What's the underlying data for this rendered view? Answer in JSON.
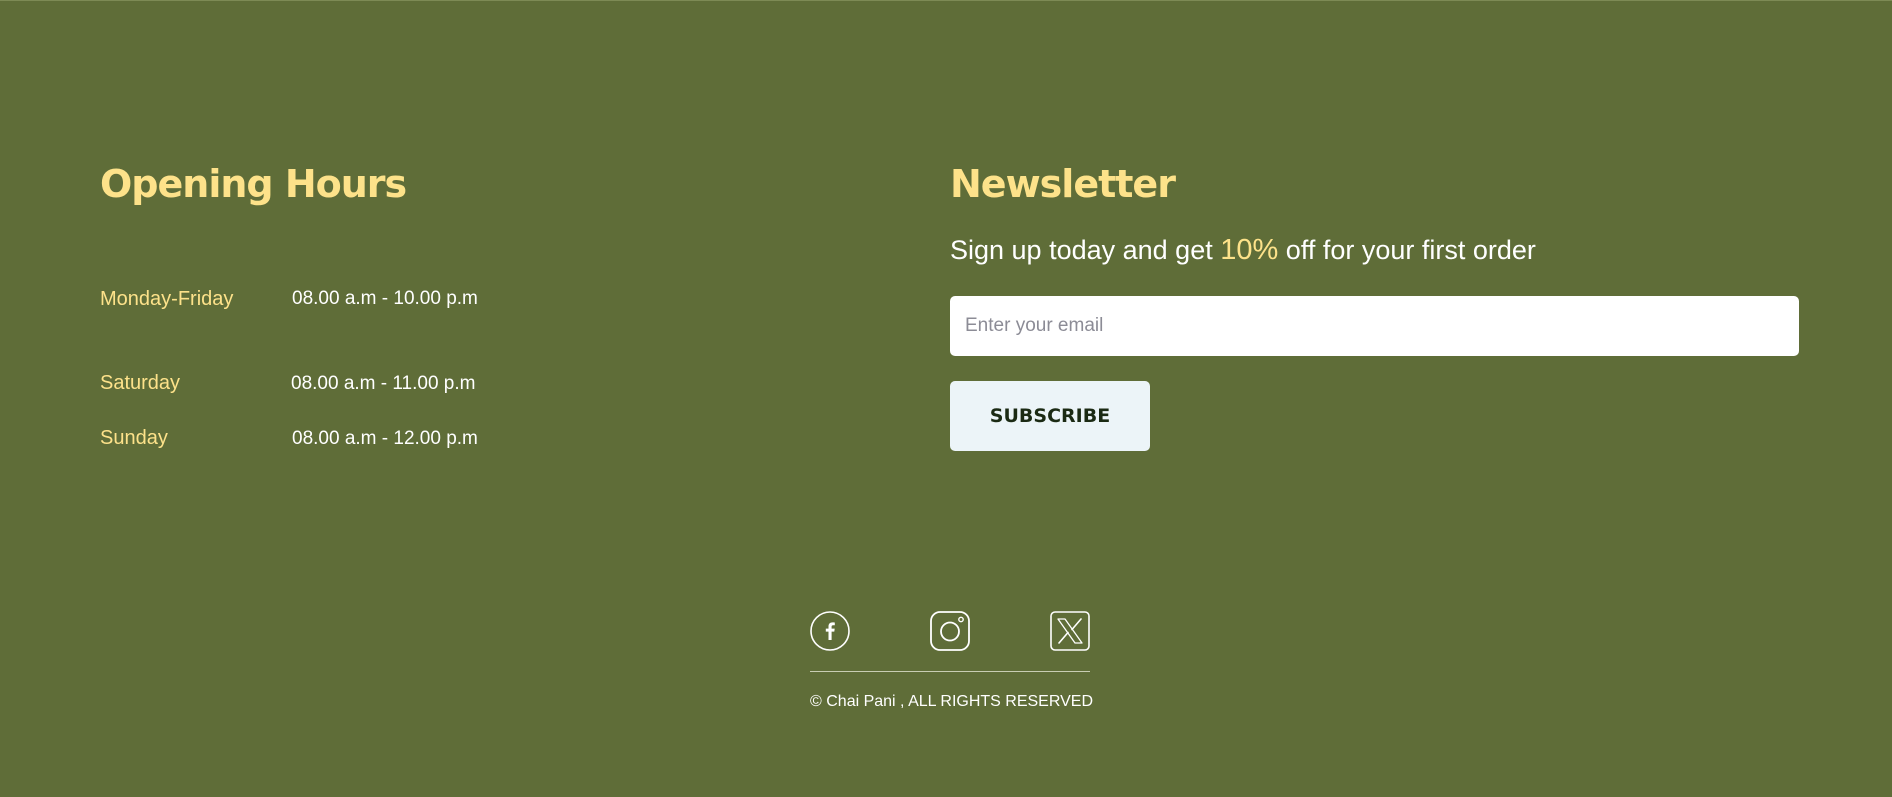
{
  "opening_hours": {
    "title": "Opening Hours",
    "rows": [
      {
        "day": "Monday-Friday",
        "time": "08.00 a.m - 10.00 p.m"
      },
      {
        "day": "Saturday",
        "time": "08.00 a.m - 11.00 p.m"
      },
      {
        "day": "Sunday",
        "time": "08.00 a.m - 12.00 p.m"
      }
    ]
  },
  "newsletter": {
    "title": "Newsletter",
    "pitch_before": "Sign up today and get",
    "pitch_highlight": "10%",
    "pitch_after": "off for your first order",
    "email_placeholder": "Enter your email",
    "email_value": "",
    "subscribe_label": "SUBSCRIBE"
  },
  "footer": {
    "social_icons": [
      "facebook-icon",
      "instagram-icon",
      "x-twitter-icon"
    ],
    "copyright": "© Chai Pani , ALL RIGHTS RESERVED"
  },
  "colors": {
    "background": "#5f6d38",
    "heading_accent": "#fde28a",
    "text": "#ffffff",
    "button_bg": "#ecf4f8",
    "button_text": "#1b2a14"
  }
}
